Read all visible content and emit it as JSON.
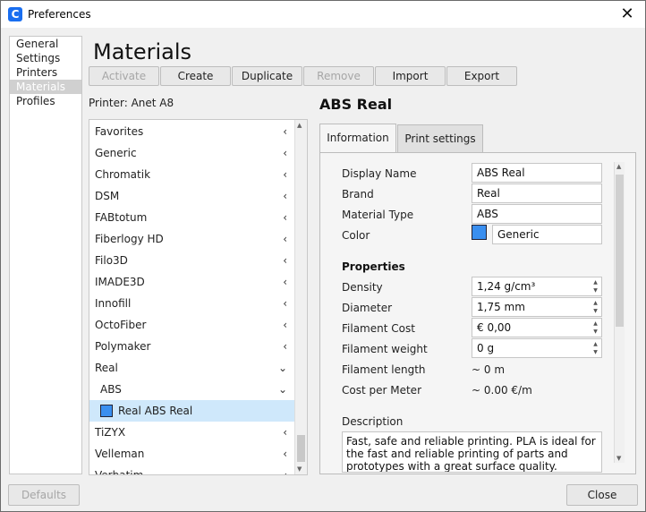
{
  "window": {
    "title": "Preferences",
    "app_icon_letter": "C",
    "close_glyph": "✕"
  },
  "nav": {
    "items": [
      {
        "label": "General"
      },
      {
        "label": "Settings"
      },
      {
        "label": "Printers"
      },
      {
        "label": "Materials",
        "active": true
      },
      {
        "label": "Profiles"
      }
    ]
  },
  "page": {
    "title": "Materials"
  },
  "toolbar": {
    "activate": "Activate",
    "create": "Create",
    "duplicate": "Duplicate",
    "remove": "Remove",
    "import": "Import",
    "export": "Export"
  },
  "printer_label": "Printer: Anet A8",
  "materials": {
    "items": [
      {
        "label": "Favorites",
        "chevron": "‹"
      },
      {
        "label": "Generic",
        "chevron": "‹"
      },
      {
        "label": "Chromatik",
        "chevron": "‹"
      },
      {
        "label": "DSM",
        "chevron": "‹"
      },
      {
        "label": "FABtotum",
        "chevron": "‹"
      },
      {
        "label": "Fiberlogy HD",
        "chevron": "‹"
      },
      {
        "label": "Filo3D",
        "chevron": "‹"
      },
      {
        "label": "IMADE3D",
        "chevron": "‹"
      },
      {
        "label": "Innofill",
        "chevron": "‹"
      },
      {
        "label": "OctoFiber",
        "chevron": "‹"
      },
      {
        "label": "Polymaker",
        "chevron": "‹"
      },
      {
        "label": "Real",
        "chevron": "⌄"
      },
      {
        "label": "ABS",
        "chevron": "⌄"
      },
      {
        "label": "Real ABS Real",
        "chevron": ""
      },
      {
        "label": "TiZYX",
        "chevron": "‹"
      },
      {
        "label": "Velleman",
        "chevron": "‹"
      },
      {
        "label": "Verbatim",
        "chevron": "‹"
      }
    ],
    "selected_color": "#3a8ff0"
  },
  "detail": {
    "title": "ABS Real",
    "tabs": {
      "information": "Information",
      "print_settings": "Print settings"
    },
    "info": {
      "display_name_label": "Display Name",
      "display_name_value": "ABS Real",
      "brand_label": "Brand",
      "brand_value": "Real",
      "material_type_label": "Material Type",
      "material_type_value": "ABS",
      "color_label": "Color",
      "color_value": "Generic",
      "color_hex": "#3a8ff0"
    },
    "properties": {
      "heading": "Properties",
      "density_label": "Density",
      "density_value": "1,24 g/cm³",
      "diameter_label": "Diameter",
      "diameter_value": "1,75 mm",
      "filament_cost_label": "Filament Cost",
      "filament_cost_value": "€ 0,00",
      "filament_weight_label": "Filament weight",
      "filament_weight_value": "0 g",
      "filament_length_label": "Filament length",
      "filament_length_value": "~ 0 m",
      "cost_per_meter_label": "Cost per Meter",
      "cost_per_meter_value": "~ 0.00 €/m"
    },
    "description": {
      "label": "Description",
      "text": "Fast, safe and reliable printing. PLA is ideal for the fast and reliable printing of parts and prototypes with a great surface quality."
    }
  },
  "footer": {
    "defaults": "Defaults",
    "close": "Close"
  }
}
